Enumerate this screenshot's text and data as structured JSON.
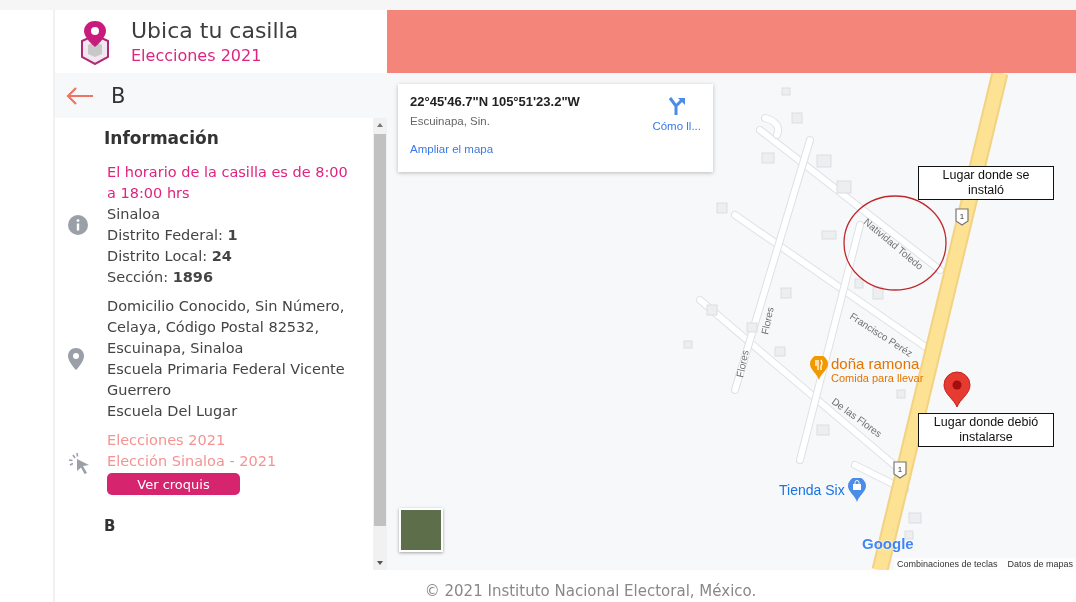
{
  "header": {
    "title": "Ubica tu casilla",
    "subtitle": "Elecciones 2021"
  },
  "sidebar": {
    "back_label": "B",
    "section_title": "Información",
    "groups": [
      {
        "kind": "info",
        "highlight": "El horario de la casilla es de 8:00 a 18:00 hrs",
        "lines": [
          "Sinaloa",
          "Distrito Federal: **1**",
          "Distrito Local: **24**",
          "Sección: **1896**"
        ]
      },
      {
        "kind": "address",
        "lines": [
          "Domicilio Conocido, Sin Número, Celaya, Código Postal 82532, Escuinapa, Sinaloa",
          "Escuela Primaria Federal Vicente Guerrero",
          "Escuela Del Lugar"
        ]
      },
      {
        "kind": "election",
        "lines": [
          "Elecciones 2021",
          "Elección Sinaloa - 2021"
        ],
        "button": "Ver croquis"
      }
    ],
    "next_heading": "B"
  },
  "map": {
    "card": {
      "coordinates": "22°45'46.7\"N 105°51'23.2\"W",
      "place": "Escuinapa, Sin.",
      "link": "Ampliar el mapa",
      "directions": "Cómo ll..."
    },
    "streets": [
      "Natividad Toledo",
      "Francisco Peréz",
      "Flores",
      "Flores",
      "De las Flores"
    ],
    "shields": [
      "1",
      "1"
    ],
    "pois": [
      {
        "kind": "food",
        "name": "doña ramona",
        "detail": "Comida para llevar"
      },
      {
        "kind": "shop",
        "name": "Tienda Six"
      }
    ],
    "annotations": [
      "Lugar donde se instaló",
      "Lugar donde debió instalarse"
    ],
    "logo": "Google",
    "attributions": [
      "Combinaciones de teclas",
      "Datos de mapas"
    ]
  },
  "footer": "© 2021 Instituto Nacional Electoral, México."
}
